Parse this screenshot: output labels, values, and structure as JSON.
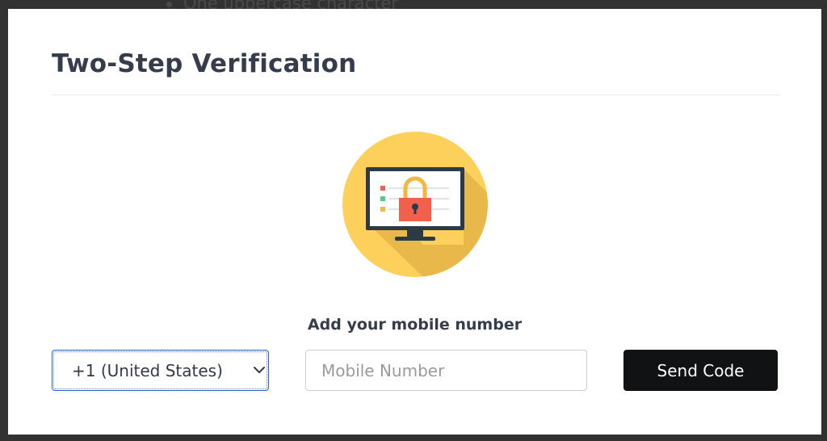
{
  "background": {
    "partial_text": "One uppercase character"
  },
  "modal": {
    "title": "Two-Step Verification"
  },
  "illustration": {
    "icon": "computer-lock-icon",
    "colors": {
      "circle": "#fdd05b",
      "shadow": "#e8b94a",
      "monitor": "#2c3a47",
      "screen": "#ffffff",
      "lock_body": "#f0604d",
      "lock_shackle": "#f5b53f",
      "dot_red": "#f0604d",
      "dot_green": "#4ecb8d",
      "dot_yellow": "#f5b53f"
    }
  },
  "form": {
    "prompt": "Add your mobile number",
    "country_select": {
      "selected": "+1 (United States)"
    },
    "mobile_input": {
      "value": "",
      "placeholder": "Mobile Number"
    },
    "send_button": {
      "label": "Send Code"
    }
  },
  "colors": {
    "title_text": "#363d4a",
    "button_bg": "#111214",
    "button_text": "#ffffff",
    "focus_border": "#2d63c8"
  }
}
